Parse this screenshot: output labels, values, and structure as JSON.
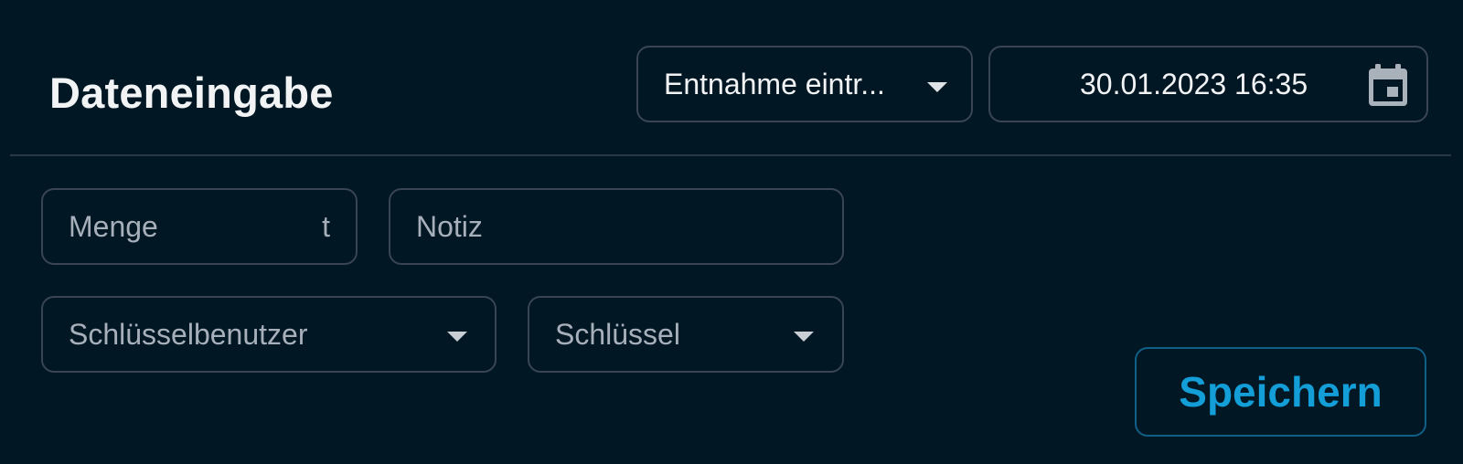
{
  "header": {
    "title": "Dateneingabe",
    "entry_type_select": {
      "value": "Entnahme eintr..."
    },
    "datetime_field": {
      "value": "30.01.2023 16:35",
      "icon": "calendar-icon"
    }
  },
  "form": {
    "menge": {
      "placeholder": "Menge",
      "unit": "t"
    },
    "notiz": {
      "placeholder": "Notiz"
    },
    "schluesselbenutzer": {
      "placeholder": "Schlüsselbenutzer",
      "icon": "chevron-down-icon"
    },
    "schluessel": {
      "placeholder": "Schlüssel",
      "icon": "chevron-down-icon"
    }
  },
  "actions": {
    "save_label": "Speichern"
  },
  "colors": {
    "background": "#011724",
    "border": "#394552",
    "text": "#f1f3f5",
    "placeholder": "#a7b0ba",
    "accent": "#139ed8"
  }
}
